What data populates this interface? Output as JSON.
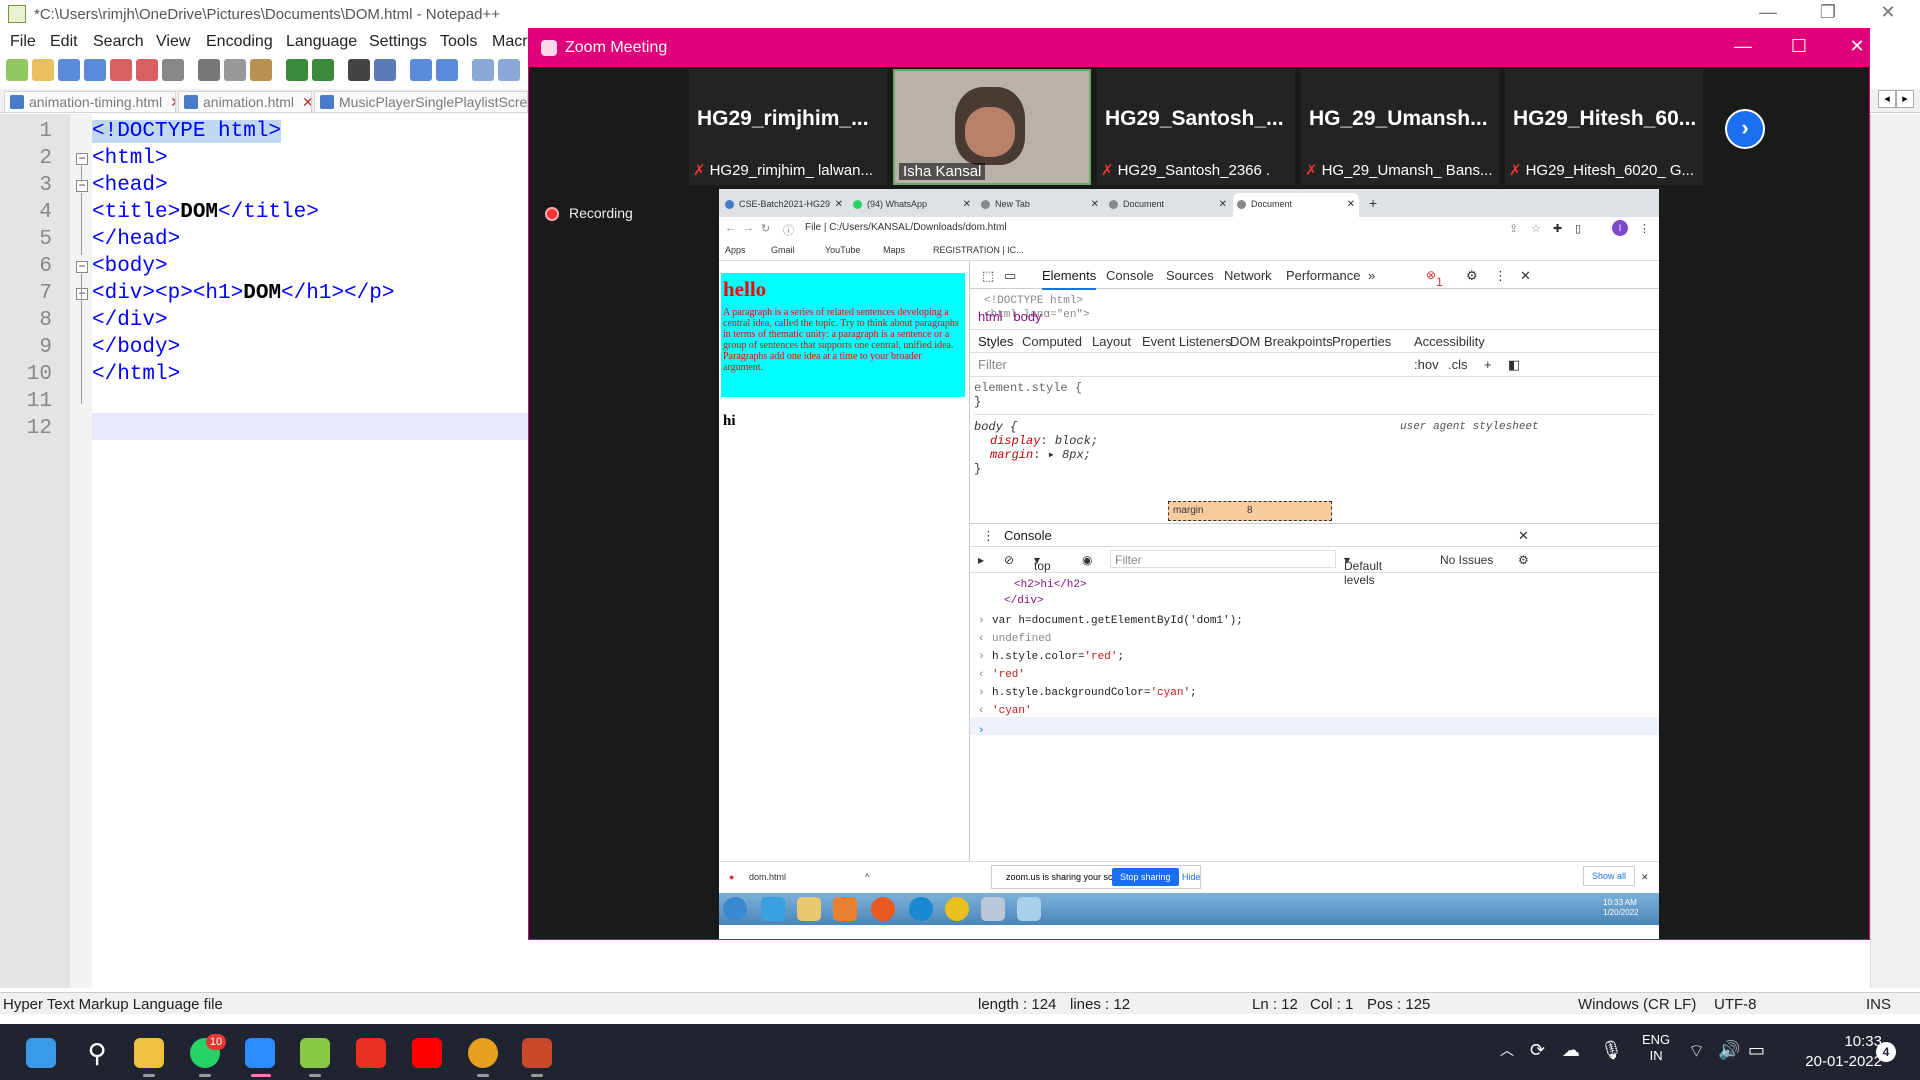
{
  "npp": {
    "title": "*C:\\Users\\rimjh\\OneDrive\\Pictures\\Documents\\DOM.html - Notepad++",
    "menu": [
      "File",
      "Edit",
      "Search",
      "View",
      "Encoding",
      "Language",
      "Settings",
      "Tools",
      "Macr"
    ],
    "tabs": [
      "animation-timing.html",
      "animation.html",
      "MusicPlayerSinglePlaylistScreen"
    ],
    "lines": [
      "1",
      "2",
      "3",
      "4",
      "5",
      "6",
      "7",
      "8",
      "9",
      "10",
      "11",
      "12"
    ],
    "code": {
      "l1": "<!DOCTYPE html>",
      "l2": "<html>",
      "l3": "<head>",
      "l4a": "<title>",
      "l4b": "DOM",
      "l4c": "</title>",
      "l5": "</head>",
      "l6": "<body>",
      "l7a": "<div><p><h1>",
      "l7b": "DOM",
      "l7c": "</h1></p>",
      "l8": "</div>",
      "l9": "</body>",
      "l10": "</html>"
    },
    "status": {
      "filetype": "Hyper Text Markup Language file",
      "length": "length : 124",
      "lines": "lines : 12",
      "ln": "Ln : 12",
      "col": "Col : 1",
      "pos": "Pos : 125",
      "eol": "Windows (CR LF)",
      "enc": "UTF-8",
      "mode": "INS"
    }
  },
  "zoom": {
    "title": "Zoom Meeting",
    "recording": "Recording",
    "participants": [
      {
        "name": "HG29_rimjhim_...",
        "label": "HG29_rimjhim_ lalwan..."
      },
      {
        "name": "",
        "label": "Isha Kansal"
      },
      {
        "name": "HG29_Santosh_...",
        "label": "HG29_Santosh_2366 ."
      },
      {
        "name": "HG_29_Umansh...",
        "label": "HG_29_Umansh_ Bans..."
      },
      {
        "name": "HG29_Hitesh_60...",
        "label": "HG29_Hitesh_6020_ G..."
      }
    ]
  },
  "browser": {
    "tabs": [
      "CSE-Batch2021-HG29",
      "(94) WhatsApp",
      "New Tab",
      "Document",
      "Document"
    ],
    "file_label": "File",
    "url": "C:/Users/KANSAL/Downloads/dom.html",
    "profile": "I",
    "bookmarks": [
      "Apps",
      "Gmail",
      "YouTube",
      "Maps",
      "REGISTRATION | IC..."
    ],
    "page": {
      "h1": "hello",
      "p": "A paragraph is a series of related sentences developing a central idea, called the topic. Try to think about paragraphs in terms of thematic unity: a paragraph is a sentence or a group of sentences that supports one central, unified idea. Paragraphs add one idea at a time to your broader argument.",
      "h2": "hi"
    },
    "devtools": {
      "tabs": [
        "Elements",
        "Console",
        "Sources",
        "Network",
        "Performance",
        "»"
      ],
      "error_count": "1",
      "dom1": "<!DOCTYPE html>",
      "dom2": "<html lang=\"en\">",
      "crumb1": "html",
      "crumb2": "body",
      "subtabs": [
        "Styles",
        "Computed",
        "Layout",
        "Event Listeners",
        "DOM Breakpoints",
        "Properties",
        "Accessibility"
      ],
      "filter": "Filter",
      "hov": ":hov",
      "cls": ".cls",
      "rule1": "element.style {",
      "close": "}",
      "rule2": "body {",
      "ua": "user agent stylesheet",
      "p1": "display",
      "v1": "block;",
      "p2": "margin",
      "v2": "8px;",
      "box_label": "margin",
      "box_val": "8",
      "console_title": "Console",
      "context": "top",
      "console_filter": "Filter",
      "levels": "Default levels",
      "issues": "No Issues",
      "c0a": "<h2>hi</h2>",
      "c0b": "</div>",
      "c1": "var h=document.getElementById('dom1');",
      "c2": "undefined",
      "c3a": "h.style.color=",
      "c3b": "'red'",
      "c3c": ";",
      "c4": "'red'",
      "c5a": "h.style.backgroundColor=",
      "c5b": "'cyan'",
      "c5c": ";",
      "c6": "'cyan'"
    },
    "download": "dom.html",
    "sharing_text": "zoom.us is sharing your screen.",
    "stop_sharing": "Stop sharing",
    "hide": "Hide",
    "show_all": "Show all",
    "win7_time": "10:33 AM",
    "win7_date": "1/20/2022"
  },
  "taskbar": {
    "whatsapp_badge": "10",
    "lang1": "ENG",
    "lang2": "IN",
    "time": "10:33",
    "date": "20-01-2022",
    "notifications": "4"
  }
}
